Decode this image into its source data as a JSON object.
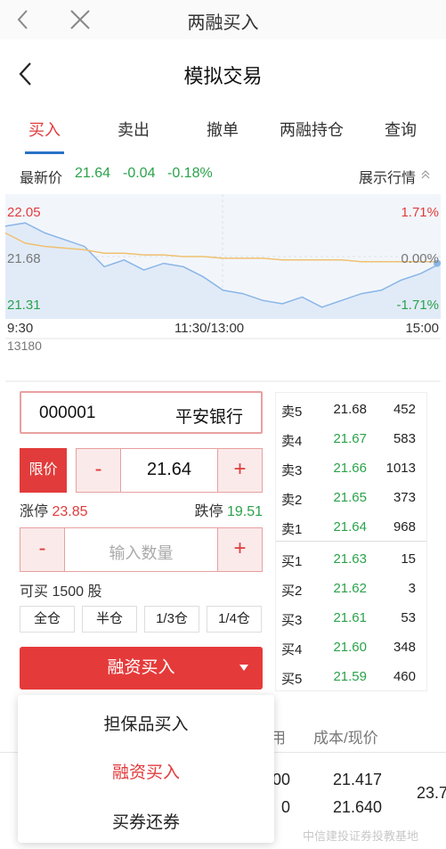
{
  "topbar": {
    "title": "两融买入"
  },
  "header": {
    "title": "模拟交易"
  },
  "tabs": [
    {
      "label": "买入"
    },
    {
      "label": "卖出"
    },
    {
      "label": "撤单"
    },
    {
      "label": "两融持仓"
    },
    {
      "label": "查询"
    }
  ],
  "quote": {
    "label": "最新价",
    "price": "21.64",
    "change": "-0.04",
    "change_pct": "-0.18%",
    "show_market": "展示行情"
  },
  "chart_data": {
    "type": "line",
    "y_top_left": "22.05",
    "y_mid_left": "21.68",
    "y_bottom_left": "21.31",
    "y_top_right": "1.71%",
    "y_mid_right": "0.00%",
    "y_bottom_right": "-1.71%",
    "x_labels": [
      "9:30",
      "11:30/13:00",
      "15:00"
    ],
    "volume_label": "13180",
    "ylim": [
      21.31,
      22.05
    ],
    "series": [
      {
        "values": [
          21.86,
          21.88,
          21.82,
          21.78,
          21.74,
          21.62,
          21.66,
          21.6,
          21.64,
          21.62,
          21.56,
          21.48,
          21.46,
          21.42,
          21.4,
          21.44,
          21.38,
          21.42,
          21.46,
          21.48,
          21.54,
          21.58,
          21.64
        ]
      },
      {
        "values": [
          21.82,
          21.76,
          21.74,
          21.73,
          21.72,
          21.7,
          21.7,
          21.69,
          21.69,
          21.68,
          21.68,
          21.67,
          21.67,
          21.67,
          21.66,
          21.66,
          21.66,
          21.66,
          21.65,
          21.65,
          21.65,
          21.65,
          21.65
        ]
      }
    ]
  },
  "stock": {
    "code": "000001",
    "name": "平安银行"
  },
  "order": {
    "limit_label": "限价",
    "minus": "-",
    "plus": "+",
    "price": "21.64",
    "limit_up_label": "涨停",
    "limit_up": "23.85",
    "limit_down_label": "跌停",
    "limit_down": "19.51",
    "qty_placeholder": "输入数量",
    "can_buy": "可买 1500 股",
    "fractions": [
      "全仓",
      "半仓",
      "1/3仓",
      "1/4仓"
    ],
    "submit": "融资买入"
  },
  "book": {
    "asks": [
      {
        "label": "卖5",
        "price": "21.68",
        "vol": "452",
        "color": "#222222"
      },
      {
        "label": "卖4",
        "price": "21.67",
        "vol": "583",
        "color": "#2aa24a"
      },
      {
        "label": "卖3",
        "price": "21.66",
        "vol": "1013",
        "color": "#2aa24a"
      },
      {
        "label": "卖2",
        "price": "21.65",
        "vol": "373",
        "color": "#2aa24a"
      },
      {
        "label": "卖1",
        "price": "21.64",
        "vol": "968",
        "color": "#2aa24a"
      }
    ],
    "bids": [
      {
        "label": "买1",
        "price": "21.63",
        "vol": "15",
        "color": "#2aa24a"
      },
      {
        "label": "买2",
        "price": "21.62",
        "vol": "3",
        "color": "#2aa24a"
      },
      {
        "label": "买3",
        "price": "21.61",
        "vol": "53",
        "color": "#2aa24a"
      },
      {
        "label": "买4",
        "price": "21.60",
        "vol": "348",
        "color": "#2aa24a"
      },
      {
        "label": "买5",
        "price": "21.59",
        "vol": "460",
        "color": "#2aa24a"
      }
    ]
  },
  "holdings": {
    "col_partial": "用",
    "col_cost": "成本/现价",
    "row1_partial": "00",
    "row1_cost": "21.417",
    "row2_partial": "0",
    "row2_cost": "21.640",
    "right_partial": "23.7"
  },
  "dropdown": {
    "items": [
      {
        "label": "担保品买入",
        "selected": false
      },
      {
        "label": "融资买入",
        "selected": true
      },
      {
        "label": "买券还券",
        "selected": false
      }
    ]
  },
  "watermark": "中信建投证券投教基地",
  "colors": {
    "red": "#e23b3b",
    "green": "#2aa24a",
    "blue": "#2a72c8"
  }
}
